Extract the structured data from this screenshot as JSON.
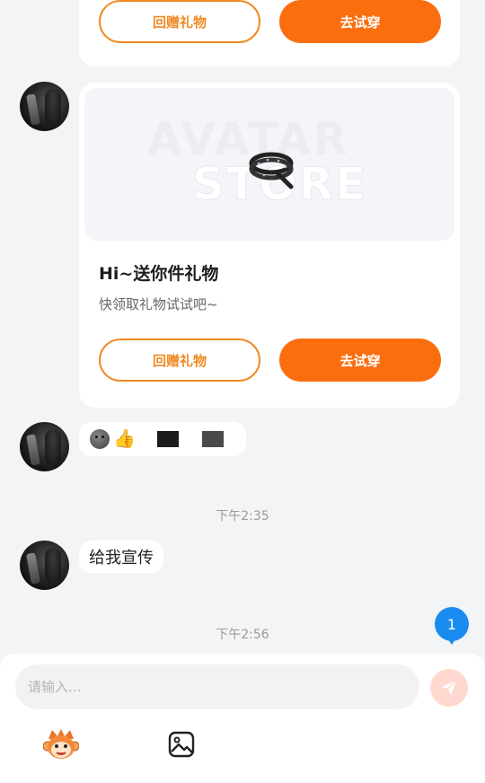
{
  "top_card": {
    "return_gift_label": "回赠礼物",
    "try_on_label": "去试穿"
  },
  "gift_card": {
    "banner_brand_line1": "AVATAR",
    "banner_brand_line2": "STORE",
    "title": "Hi~送你件礼物",
    "subtitle": "快领取礼物试试吧~",
    "return_gift_label": "回赠礼物",
    "try_on_label": "去试穿"
  },
  "messages": {
    "timestamp_1": "下午2:35",
    "message_text": "给我宣传",
    "timestamp_2": "下午2:56"
  },
  "unread_badge": "1",
  "composer": {
    "placeholder": "请输入..."
  },
  "icons": {
    "send": "send-icon",
    "mascot": "monkey-mascot-icon",
    "image": "image-icon"
  },
  "colors": {
    "accent_orange": "#fa6e0f",
    "outline_orange": "#f08a24",
    "badge_blue": "#1a8cf0",
    "send_bg": "#ffd9d0"
  }
}
